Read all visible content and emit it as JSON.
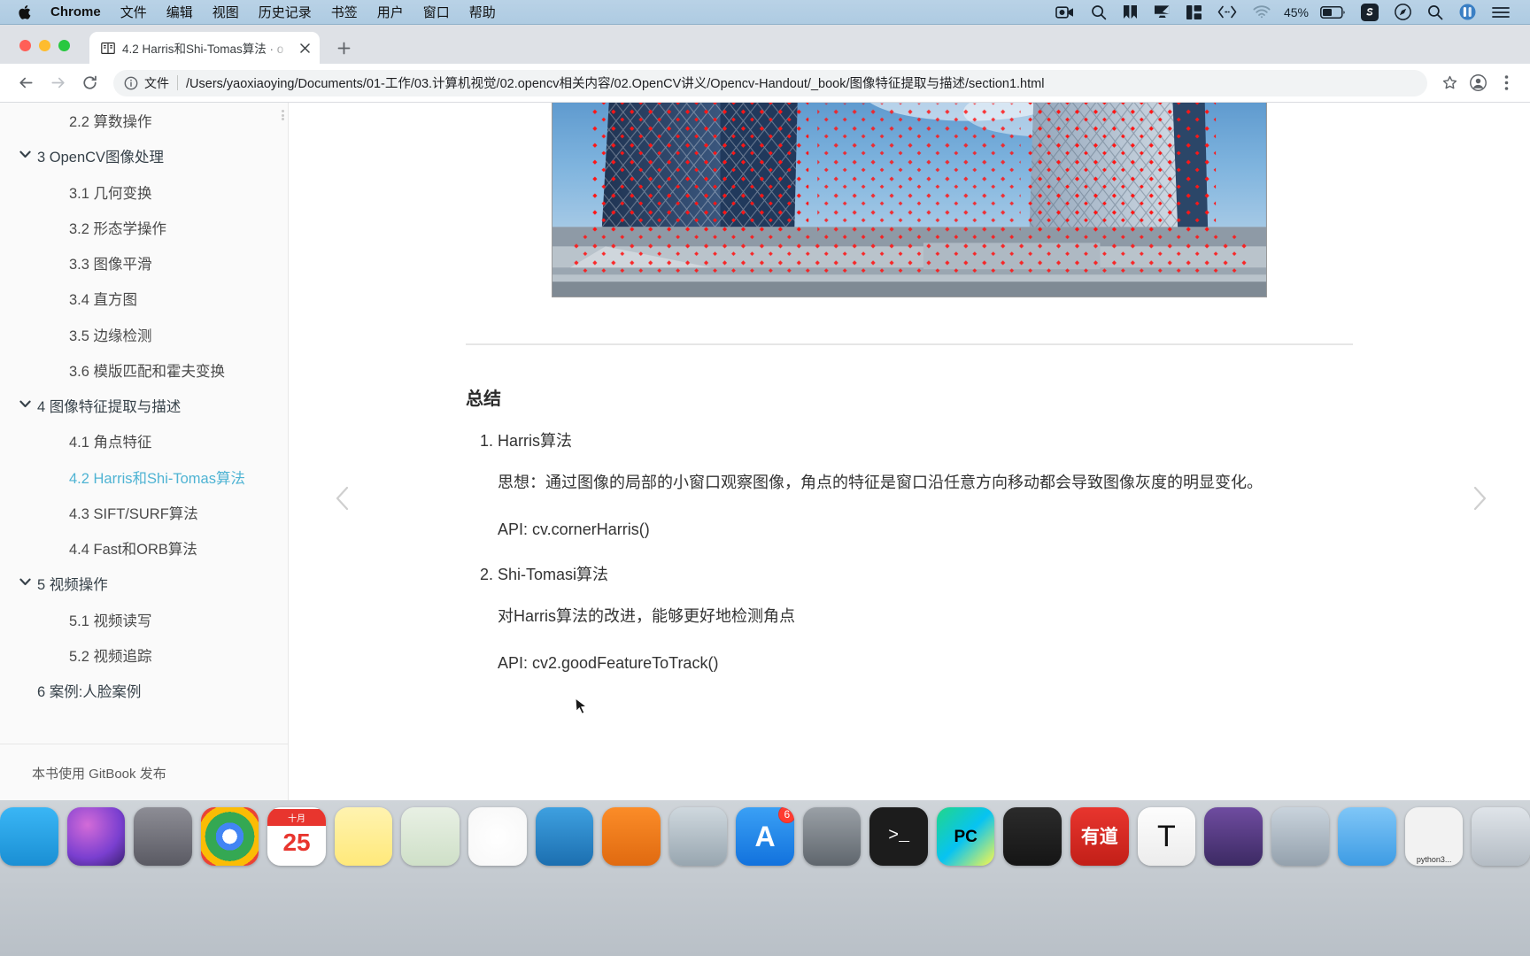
{
  "menubar": {
    "apple_icon": "apple-logo-icon",
    "items": [
      "Chrome",
      "文件",
      "编辑",
      "视图",
      "历史记录",
      "书签",
      "用户",
      "窗口",
      "帮助"
    ],
    "status_icons": [
      "screen-record-icon",
      "magnifier-icon",
      "bookmark-icon",
      "airplay-display-icon",
      "split-layout-icon",
      "code-brackets-icon",
      "wifi-icon"
    ],
    "battery_percent": "45%",
    "battery_icon": "battery-icon",
    "right_icons": [
      "sogou-input-icon",
      "compass-safari-icon",
      "spotlight-search-icon",
      "control-center-icon",
      "menu-list-icon"
    ]
  },
  "browser": {
    "tab": {
      "favicon": "book-icon",
      "title": "4.2 Harris和Shi-Tomas算法 · o",
      "close_icon": "close-icon"
    },
    "new_tab_icon": "plus-icon",
    "toolbar": {
      "back_icon": "arrow-back-icon",
      "forward_icon": "arrow-forward-icon",
      "reload_icon": "reload-icon",
      "info_icon": "info-circle-icon",
      "scheme_label": "文件",
      "url": "/Users/yaoxiaoying/Documents/01-工作/03.计算机视觉/02.opencv相关内容/02.OpenCV讲义/Opencv-Handout/_book/图像特征提取与描述/section1.html",
      "bookmark_icon": "star-icon",
      "profile_icon": "account-circle-icon",
      "menu_icon": "three-dots-menu-icon"
    }
  },
  "sidebar": {
    "items": [
      {
        "label": "2.2 算数操作",
        "level": 2,
        "arrow": false,
        "active": false
      },
      {
        "label": "3 OpenCV图像处理",
        "level": 1,
        "arrow": true,
        "active": false
      },
      {
        "label": "3.1 几何变换",
        "level": 2,
        "arrow": false,
        "active": false
      },
      {
        "label": "3.2 形态学操作",
        "level": 2,
        "arrow": false,
        "active": false
      },
      {
        "label": "3.3 图像平滑",
        "level": 2,
        "arrow": false,
        "active": false
      },
      {
        "label": "3.4 直方图",
        "level": 2,
        "arrow": false,
        "active": false
      },
      {
        "label": "3.5 边缘检测",
        "level": 2,
        "arrow": false,
        "active": false
      },
      {
        "label": "3.6 模版匹配和霍夫变换",
        "level": 2,
        "arrow": false,
        "active": false
      },
      {
        "label": "4 图像特征提取与描述",
        "level": 1,
        "arrow": true,
        "active": false
      },
      {
        "label": "4.1 角点特征",
        "level": 2,
        "arrow": false,
        "active": false
      },
      {
        "label": "4.2 Harris和Shi-Tomas算法",
        "level": 2,
        "arrow": false,
        "active": true
      },
      {
        "label": "4.3 SIFT/SURF算法",
        "level": 2,
        "arrow": false,
        "active": false
      },
      {
        "label": "4.4 Fast和ORB算法",
        "level": 2,
        "arrow": false,
        "active": false
      },
      {
        "label": "5 视频操作",
        "level": 1,
        "arrow": true,
        "active": false
      },
      {
        "label": "5.1 视频读写",
        "level": 2,
        "arrow": false,
        "active": false
      },
      {
        "label": "5.2 视频追踪",
        "level": 2,
        "arrow": false,
        "active": false
      },
      {
        "label": "6 案例:人脸案例",
        "level": 1,
        "arrow": false,
        "active": false
      }
    ],
    "footer": "本书使用 GitBook 发布",
    "active_color": "#4eb3d3"
  },
  "content": {
    "figure_alt": "CCTV大楼角点检测结果图",
    "section_title": "总结",
    "list": [
      {
        "title": "Harris算法",
        "paragraphs": [
          "思想：通过图像的局部的小窗口观察图像，角点的特征是窗口沿任意方向移动都会导致图像灰度的明显变化。",
          "API: cv.cornerHarris()"
        ]
      },
      {
        "title": "Shi-Tomasi算法",
        "paragraphs": [
          "对Harris算法的改进，能够更好地检测角点",
          "API: cv2.goodFeatureToTrack()"
        ]
      }
    ],
    "prev_icon": "chevron-left-icon",
    "next_icon": "chevron-right-icon"
  },
  "dock": {
    "apps": [
      {
        "name": "finder",
        "glyph": "",
        "bg": "linear-gradient(180deg,#3ab6f5 0%,#1a8fd4 100%)",
        "badge": null,
        "label": ""
      },
      {
        "name": "siri",
        "glyph": "",
        "bg": "radial-gradient(circle at 35% 30%,#d36bd8,#7a3fd0 60%,#3a2070)",
        "badge": null,
        "label": ""
      },
      {
        "name": "launchpad",
        "glyph": "",
        "bg": "linear-gradient(180deg,#8d8d95 0%,#5a5a63 100%)",
        "badge": null,
        "label": ""
      },
      {
        "name": "chrome",
        "glyph": "",
        "bg": "radial-gradient(circle at 50% 50%,#fff 0 18%,#4285f4 18% 34%,#34a853 34% 60%,#fbbc05 60% 78%,#ea4335 78%)",
        "badge": null,
        "label": ""
      },
      {
        "name": "calendar",
        "glyph": "25",
        "bg": "#ffffff",
        "badge": null,
        "label": "十月"
      },
      {
        "name": "notes",
        "glyph": "",
        "bg": "linear-gradient(180deg,#fff3b0 0%,#ffe97a 100%)",
        "badge": null,
        "label": ""
      },
      {
        "name": "maps",
        "glyph": "",
        "bg": "linear-gradient(180deg,#e8f0e4 0%,#cfe0c8 100%)",
        "badge": null,
        "label": ""
      },
      {
        "name": "photos",
        "glyph": "",
        "bg": "radial-gradient(circle at 50% 50%,#fff,#f7f7f7)",
        "badge": null,
        "label": ""
      },
      {
        "name": "keynote",
        "glyph": "",
        "bg": "linear-gradient(180deg,#3ea0e0 0%,#1c6fb0 100%)",
        "badge": null,
        "label": ""
      },
      {
        "name": "pages",
        "glyph": "",
        "bg": "linear-gradient(180deg,#fb8c28 0%,#e06a10 100%)",
        "badge": null,
        "label": ""
      },
      {
        "name": "preview",
        "glyph": "",
        "bg": "linear-gradient(180deg,#cfd8de 0%,#98a6b0 100%)",
        "badge": null,
        "label": ""
      },
      {
        "name": "app-store",
        "glyph": "A",
        "bg": "linear-gradient(180deg,#3aa0f5 0%,#1272dd 100%)",
        "badge": "6",
        "label": ""
      },
      {
        "name": "system-preferences",
        "glyph": "",
        "bg": "linear-gradient(180deg,#9aa0a6 0%,#5f666d 100%)",
        "badge": null,
        "label": ""
      },
      {
        "name": "terminal",
        "glyph": ">_",
        "bg": "#1c1c1c",
        "badge": null,
        "label": ""
      },
      {
        "name": "pycharm",
        "glyph": "PC",
        "bg": "linear-gradient(135deg,#21d789 0%,#07c3f2 50%,#fcf84a 100%)",
        "badge": null,
        "label": ""
      },
      {
        "name": "sublime-text",
        "glyph": "",
        "bg": "linear-gradient(180deg,#2b2b2b 0%,#151515 100%)",
        "badge": null,
        "label": ""
      },
      {
        "name": "youdao-dict",
        "glyph": "有道",
        "bg": "linear-gradient(180deg,#e8352e 0%,#c21f18 100%)",
        "badge": null,
        "label": ""
      },
      {
        "name": "font-book",
        "glyph": "T",
        "bg": "linear-gradient(180deg,#fdfdfd 0%,#ececec 100%)",
        "badge": null,
        "label": ""
      },
      {
        "name": "imovie",
        "glyph": "",
        "bg": "linear-gradient(180deg,#6f4ca0 0%,#3c2a63 100%)",
        "badge": null,
        "label": ""
      },
      {
        "name": "image-capture",
        "glyph": "",
        "bg": "linear-gradient(180deg,#c9d3dc 0%,#94a1ad 100%)",
        "badge": null,
        "label": ""
      },
      {
        "name": "folder",
        "glyph": "",
        "bg": "linear-gradient(180deg,#7fc6f7 0%,#3e9ce4 100%)",
        "badge": null,
        "label": ""
      },
      {
        "name": "python3-terminal",
        "glyph": "",
        "bg": "#f2f2f2",
        "badge": null,
        "label": "python3..."
      },
      {
        "name": "trash",
        "glyph": "",
        "bg": "linear-gradient(180deg,#dfe4e9 0%,#b4bcc4 100%)",
        "badge": null,
        "label": ""
      }
    ]
  }
}
